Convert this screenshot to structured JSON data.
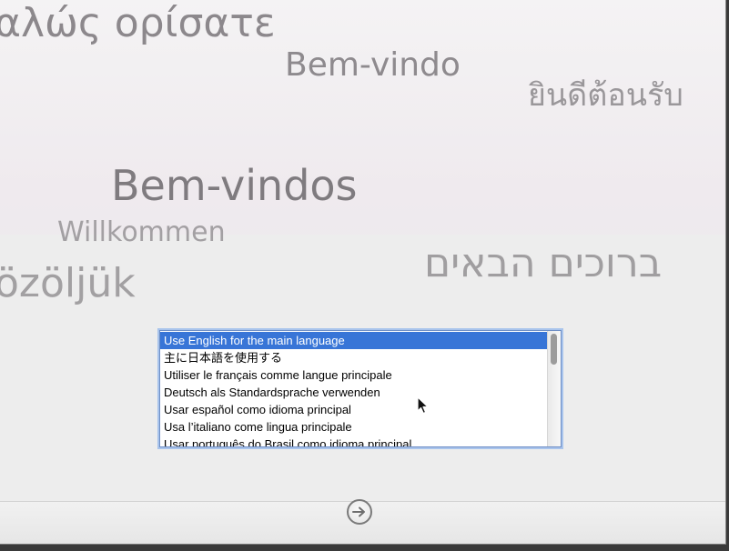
{
  "greetings": {
    "greek": "αλώς ορίσατε",
    "portuguese_pt": "Bem-vindo",
    "thai": "ยินดีต้อนรับ",
    "portuguese_br": "Bem-vindos",
    "german": "Willkommen",
    "hungarian": "özöljük",
    "hebrew": "ברוכים הבאים"
  },
  "language_list": {
    "selected_index": 0,
    "items": [
      "Use English for the main language",
      "主に日本語を使用する",
      "Utiliser le français comme langue principale",
      "Deutsch als Standardsprache verwenden",
      "Usar español como idioma principal",
      "Usa l’italiano come lingua principale",
      "Usar português do Brasil como idioma principal"
    ]
  },
  "icons": {
    "continue": "arrow-right-circle-icon",
    "cursor": "mouse-pointer-icon"
  },
  "colors": {
    "selection": "#3875d7",
    "focus_ring": "#a9c4ec"
  }
}
